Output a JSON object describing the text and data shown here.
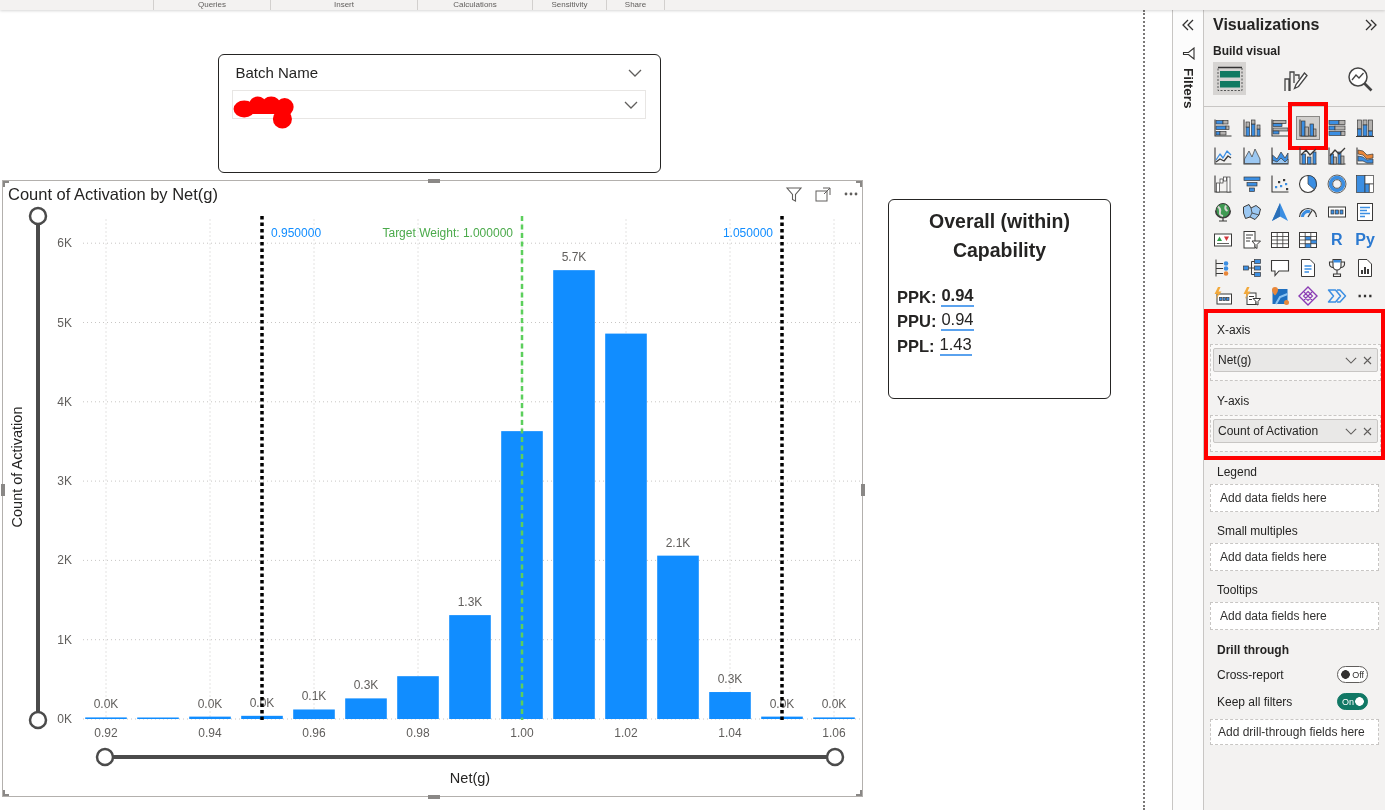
{
  "ribbon": {
    "groups": [
      "Queries",
      "Insert",
      "Calculations",
      "Sensitivity",
      "Share"
    ]
  },
  "canvas": {
    "visuals": [
      {
        "kind": "slicer",
        "selected": false,
        "title": "Batch Name",
        "value_redacted": true
      },
      {
        "kind": "chart",
        "selected": true,
        "chart_data": {
          "type": "bar",
          "title": "Count of Activation by Net(g)",
          "xlabel": "Net(g)",
          "ylabel": "Count of Activation",
          "x": [
            0.92,
            0.93,
            0.94,
            0.95,
            0.96,
            0.97,
            0.98,
            0.99,
            1.0,
            1.01,
            1.02,
            1.03,
            1.04,
            1.05,
            1.06
          ],
          "series": [
            {
              "color": "#118dff",
              "values": [
                20,
                10,
                30,
                40,
                120,
                260,
                540,
                1310,
                3630,
                5660,
                4860,
                2060,
                340,
                30,
                20
              ]
            }
          ],
          "xlim": [
            0.92,
            1.06
          ],
          "ylim": [
            0,
            6000
          ],
          "xticks": [
            0.92,
            0.94,
            0.96,
            0.98,
            {
              "value": 1,
              "label": "1.00"
            },
            1.02,
            1.04,
            1.06
          ],
          "yticks": [
            {
              "value": 0,
              "label": "0K"
            },
            {
              "value": 1000,
              "label": "1K"
            },
            {
              "value": 2000,
              "label": "2K"
            },
            {
              "value": 3000,
              "label": "3K"
            },
            {
              "value": 4000,
              "label": "4K"
            },
            {
              "value": 5000,
              "label": "5K"
            },
            {
              "value": 6000,
              "label": "6K"
            }
          ],
          "grid": true,
          "value_labels": [
            "0.0K",
            null,
            "0.0K",
            "0.0K",
            "0.1K",
            "0.3K",
            null,
            "1.3K",
            null,
            "5.7K",
            null,
            "2.1K",
            "0.3K",
            "0.0K",
            "0.0K"
          ],
          "ref_lines": [
            {
              "axis": "x",
              "value": 0.95,
              "label": "0.950000",
              "color": "#000000"
            },
            {
              "axis": "x",
              "value": 1.0,
              "label": "Target Weight: 1.000000",
              "color": "#5ccf5c"
            },
            {
              "axis": "x",
              "value": 1.05,
              "label": "1.050000",
              "color": "#000000"
            }
          ]
        }
      },
      {
        "kind": "card",
        "selected": false,
        "title": "Overall (within) Capability",
        "metrics": [
          {
            "label": "PPK:",
            "value": "0.94",
            "bold": true
          },
          {
            "label": "PPU:",
            "value": "0.94",
            "bold": false
          },
          {
            "label": "PPL:",
            "value": "1.43",
            "bold": false
          }
        ]
      }
    ]
  },
  "filters_pane": {
    "title": "Filters"
  },
  "visualizations_pane": {
    "title": "Visualizations",
    "subtitle": "Build visual",
    "tabs": [
      {
        "selected": true
      },
      {
        "selected": false
      },
      {
        "selected": false
      }
    ],
    "visual_types": [
      {
        "kind": "icon",
        "selected": false,
        "highlighted": false
      },
      {
        "kind": "icon",
        "selected": false,
        "highlighted": false
      },
      {
        "kind": "icon",
        "selected": false,
        "highlighted": false
      },
      {
        "kind": "icon",
        "selected": true,
        "highlighted": true
      },
      {
        "kind": "icon",
        "selected": false,
        "highlighted": false
      },
      {
        "kind": "icon",
        "selected": false,
        "highlighted": false
      },
      {
        "kind": "icon",
        "selected": false,
        "highlighted": false
      },
      {
        "kind": "icon",
        "selected": false,
        "highlighted": false
      },
      {
        "kind": "icon",
        "selected": false,
        "highlighted": false
      },
      {
        "kind": "icon",
        "selected": false,
        "highlighted": false
      },
      {
        "kind": "icon",
        "selected": false,
        "highlighted": false
      },
      {
        "kind": "icon",
        "selected": false,
        "highlighted": false
      },
      {
        "kind": "icon",
        "selected": false,
        "highlighted": false
      },
      {
        "kind": "icon",
        "selected": false,
        "highlighted": false
      },
      {
        "kind": "icon",
        "selected": false,
        "highlighted": false
      },
      {
        "kind": "icon",
        "selected": false,
        "highlighted": false
      },
      {
        "kind": "icon",
        "selected": false,
        "highlighted": false
      },
      {
        "kind": "icon",
        "selected": false,
        "highlighted": false
      },
      {
        "kind": "icon",
        "selected": false,
        "highlighted": false
      },
      {
        "kind": "icon",
        "selected": false,
        "highlighted": false
      },
      {
        "kind": "icon",
        "selected": false,
        "highlighted": false
      },
      {
        "kind": "icon",
        "selected": false,
        "highlighted": false
      },
      {
        "kind": "icon",
        "selected": false,
        "highlighted": false
      },
      {
        "kind": "icon",
        "selected": false,
        "highlighted": false
      },
      {
        "kind": "icon",
        "selected": false,
        "highlighted": false
      },
      {
        "kind": "icon",
        "selected": false,
        "highlighted": false
      },
      {
        "kind": "icon",
        "selected": false,
        "highlighted": false
      },
      {
        "kind": "icon",
        "selected": false,
        "highlighted": false
      },
      {
        "kind": "glyph",
        "glyph": "R",
        "selected": false,
        "highlighted": false
      },
      {
        "kind": "glyph",
        "glyph": "Py",
        "selected": false,
        "highlighted": false
      },
      {
        "kind": "icon",
        "selected": false,
        "highlighted": false
      },
      {
        "kind": "icon",
        "selected": false,
        "highlighted": false
      },
      {
        "kind": "icon",
        "selected": false,
        "highlighted": false
      },
      {
        "kind": "icon",
        "selected": false,
        "highlighted": false
      },
      {
        "kind": "icon",
        "selected": false,
        "highlighted": false
      },
      {
        "kind": "icon",
        "selected": false,
        "highlighted": false
      },
      {
        "kind": "icon",
        "selected": false,
        "highlighted": false
      },
      {
        "kind": "icon",
        "selected": false,
        "highlighted": false
      },
      {
        "kind": "icon",
        "selected": false,
        "highlighted": false
      },
      {
        "kind": "icon",
        "selected": false,
        "highlighted": false
      },
      {
        "kind": "icon",
        "selected": false,
        "highlighted": false
      },
      {
        "kind": "glyph",
        "glyph": "⋯",
        "selected": false,
        "highlighted": false
      }
    ],
    "wells": [
      {
        "kind": "filled",
        "label": "X-axis",
        "fields": [
          "Net(g)"
        ],
        "highlighted": true
      },
      {
        "kind": "filled",
        "label": "Y-axis",
        "fields": [
          "Count of Activation"
        ],
        "highlighted": true
      },
      {
        "kind": "empty",
        "label": "Legend",
        "placeholder": "Add data fields here",
        "highlighted": false
      },
      {
        "kind": "empty",
        "label": "Small multiples",
        "placeholder": "Add data fields here",
        "highlighted": false
      },
      {
        "kind": "empty",
        "label": "Tooltips",
        "placeholder": "Add data fields here",
        "highlighted": false
      }
    ],
    "drill_through": {
      "title": "Drill through",
      "toggles": [
        {
          "label": "Cross-report",
          "on": false,
          "state_text": "Off"
        },
        {
          "label": "Keep all filters",
          "on": true,
          "state_text": "On"
        }
      ],
      "placeholder": "Add drill-through fields here"
    }
  }
}
